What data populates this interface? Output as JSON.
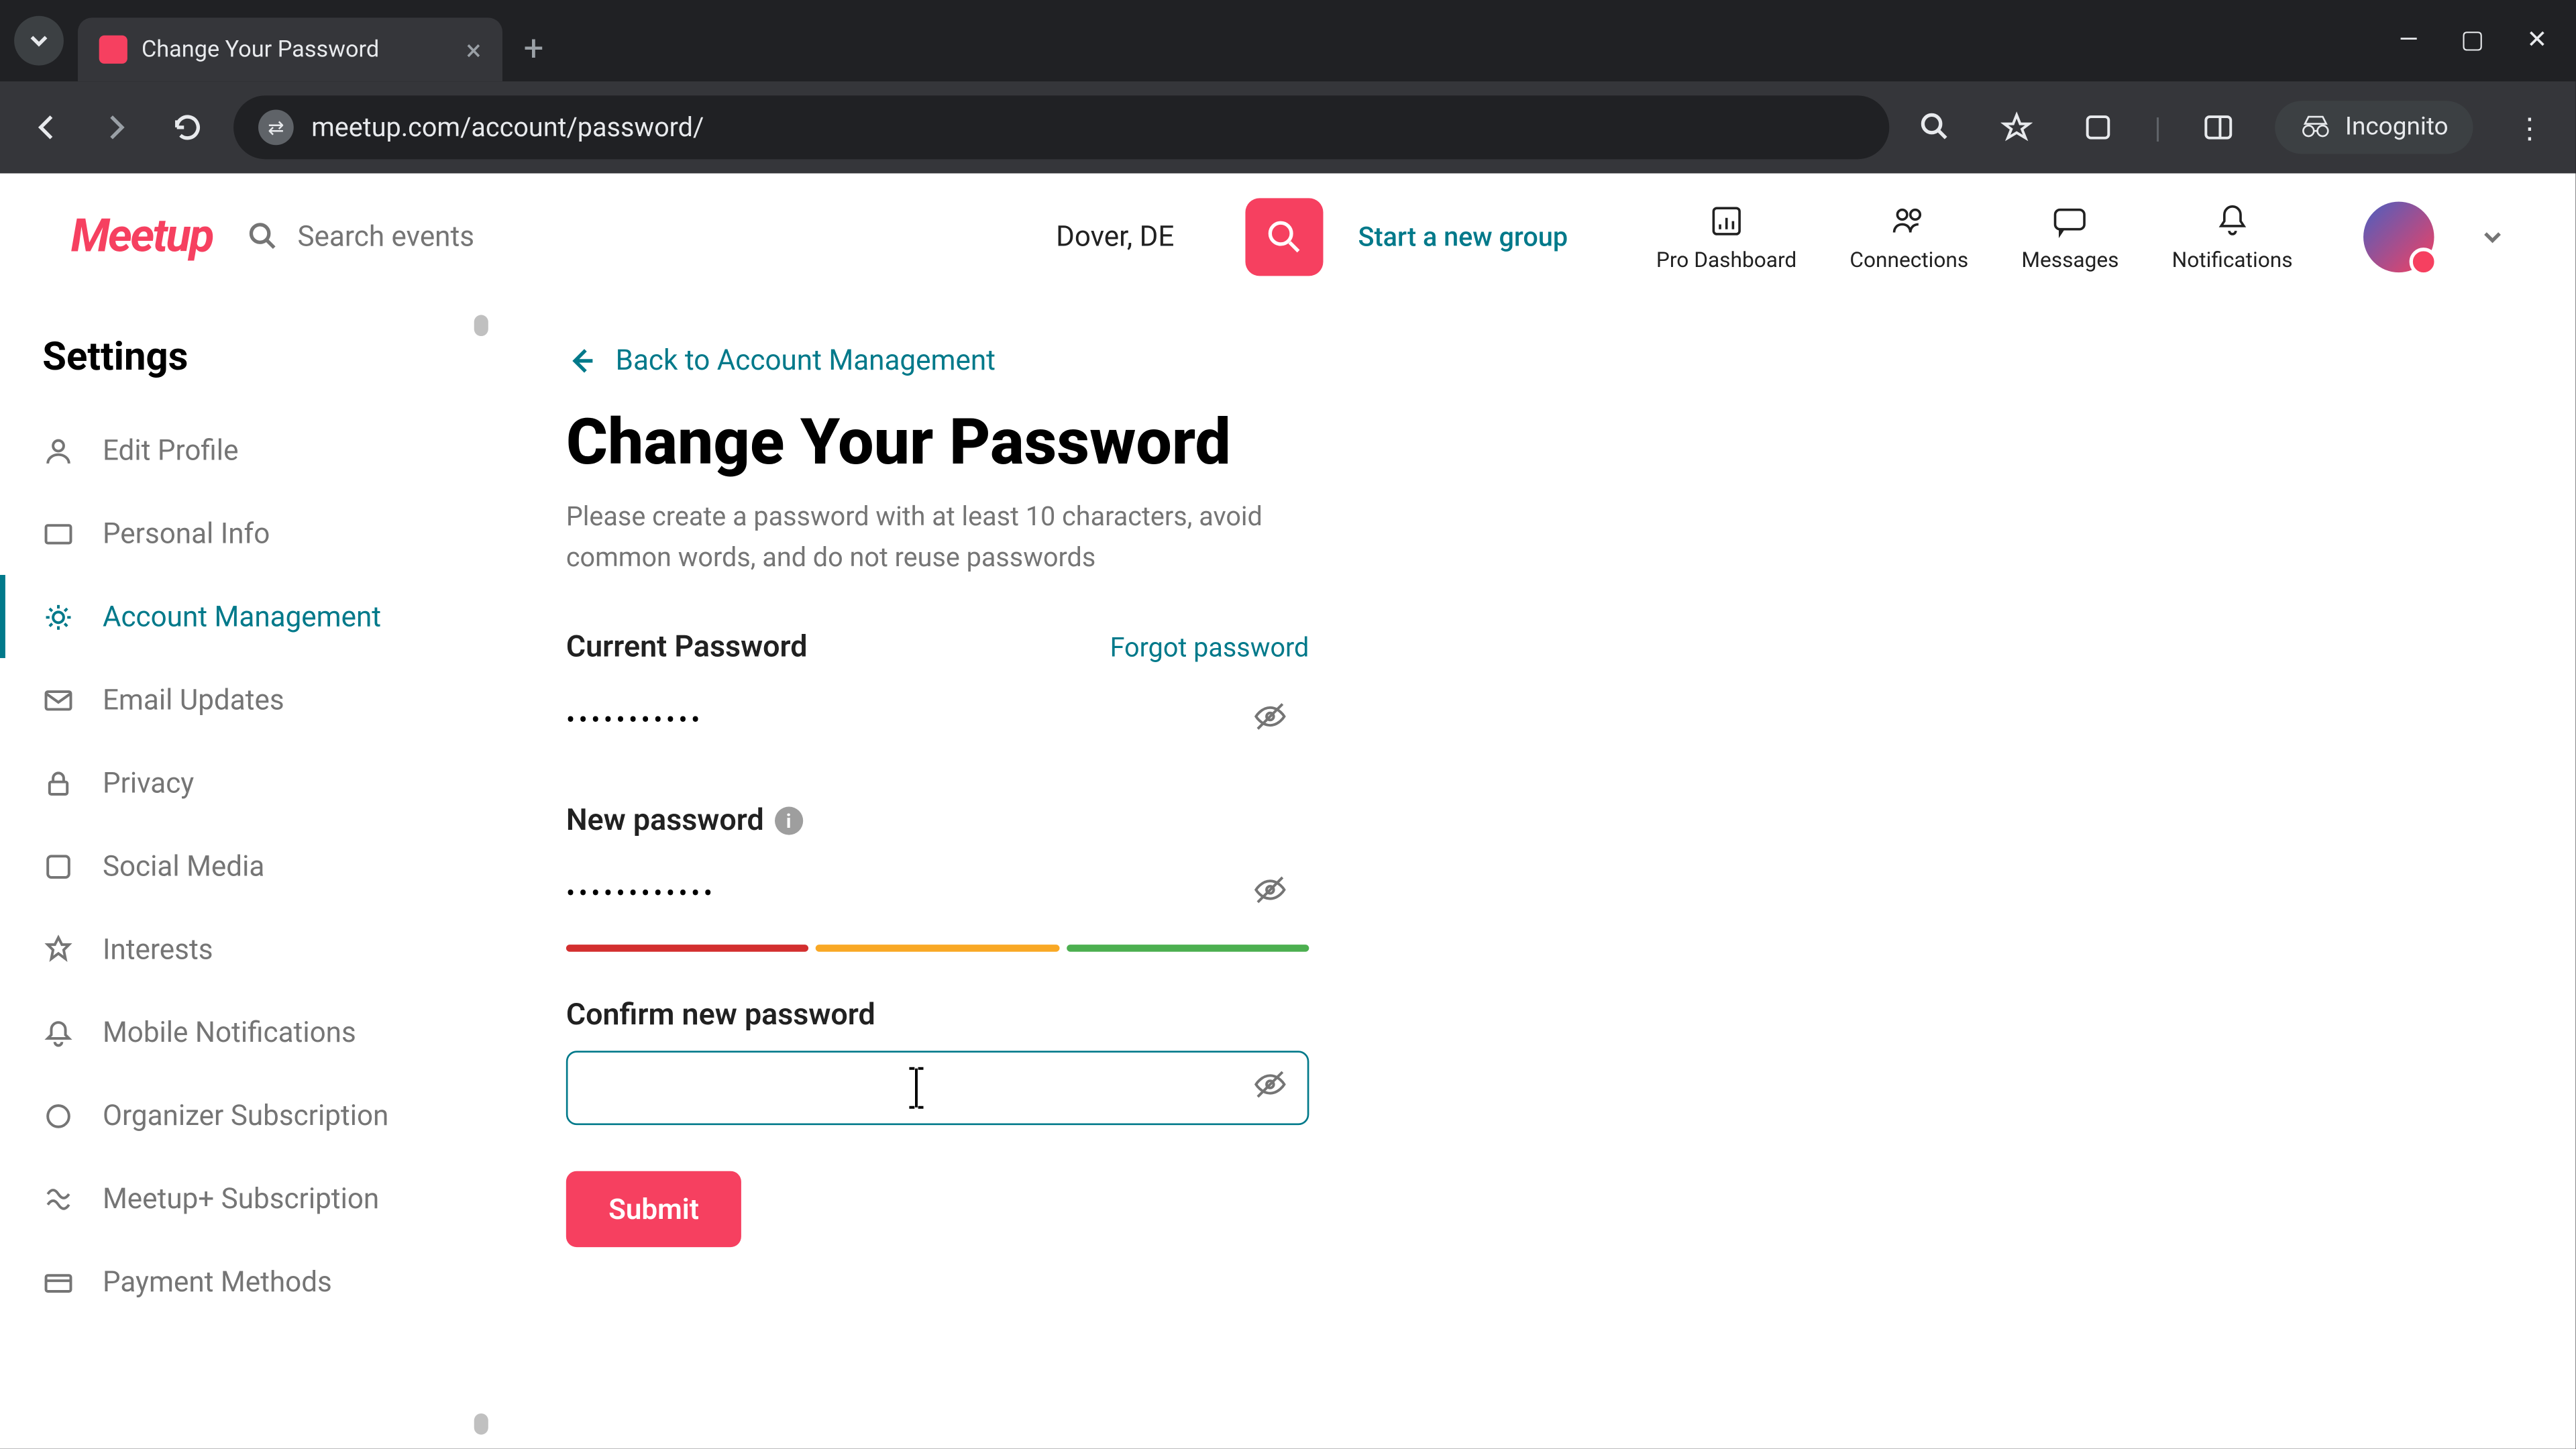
{
  "browser": {
    "tab_title": "Change Your Password",
    "url": "meetup.com/account/password/",
    "incognito_label": "Incognito"
  },
  "header": {
    "logo_text": "Meetup",
    "search_placeholder": "Search events",
    "location": "Dover, DE",
    "start_group": "Start a new group",
    "nav": [
      {
        "label": "Pro Dashboard"
      },
      {
        "label": "Connections"
      },
      {
        "label": "Messages"
      },
      {
        "label": "Notifications"
      }
    ]
  },
  "sidebar": {
    "title": "Settings",
    "items": [
      {
        "label": "Edit Profile",
        "icon": "person"
      },
      {
        "label": "Personal Info",
        "icon": "id"
      },
      {
        "label": "Account Management",
        "icon": "gear",
        "active": true
      },
      {
        "label": "Email Updates",
        "icon": "mail"
      },
      {
        "label": "Privacy",
        "icon": "lock"
      },
      {
        "label": "Social Media",
        "icon": "share"
      },
      {
        "label": "Interests",
        "icon": "star"
      },
      {
        "label": "Mobile Notifications",
        "icon": "bell"
      },
      {
        "label": "Organizer Subscription",
        "icon": "badge"
      },
      {
        "label": "Meetup+ Subscription",
        "icon": "plus"
      },
      {
        "label": "Payment Methods",
        "icon": "card"
      }
    ]
  },
  "main": {
    "back_link": "Back to Account Management",
    "title": "Change Your Password",
    "description": "Please create a password with at least 10 characters, avoid common words, and do not reuse passwords",
    "current_password": {
      "label": "Current Password",
      "forgot": "Forgot password",
      "value": "•••••••••••"
    },
    "new_password": {
      "label": "New password",
      "value": "••••••••••••",
      "strength_colors": [
        "#d32f2f",
        "#f9a825",
        "#4caf50"
      ]
    },
    "confirm_password": {
      "label": "Confirm new password",
      "value": ""
    },
    "submit": "Submit"
  }
}
